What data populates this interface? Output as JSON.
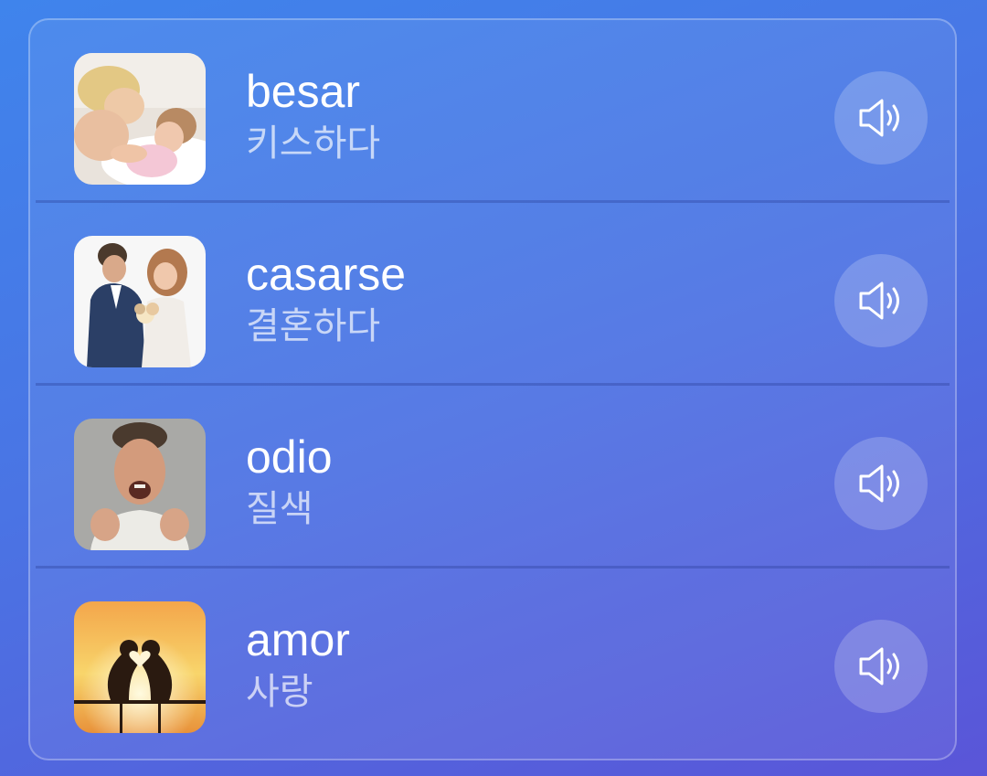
{
  "words": [
    {
      "word": "besar",
      "translation": "키스하다",
      "image": "mother-kissing-daughter-photo",
      "icon": "speaker-icon"
    },
    {
      "word": "casarse",
      "translation": "결혼하다",
      "image": "wedding-couple-photo",
      "icon": "speaker-icon"
    },
    {
      "word": "odio",
      "translation": "질색",
      "image": "angry-man-photo",
      "icon": "speaker-icon"
    },
    {
      "word": "amor",
      "translation": "사랑",
      "image": "birds-heart-sunset-photo",
      "icon": "speaker-icon"
    }
  ],
  "colors": {
    "background_top": "#3f84ec",
    "background_bottom": "#5a55d8",
    "text_primary": "#ffffff"
  }
}
